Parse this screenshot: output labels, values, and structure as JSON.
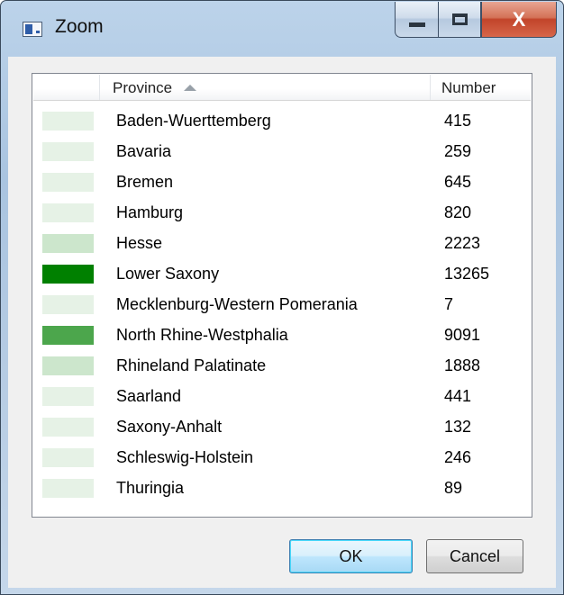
{
  "window": {
    "title": "Zoom",
    "icon": "app-window-icon"
  },
  "caption_buttons": {
    "minimize_icon": "minimize-icon",
    "maximize_icon": "maximize-icon",
    "close_label": "X"
  },
  "list": {
    "columns": [
      {
        "label": ""
      },
      {
        "label": "Province",
        "sort": "ascending"
      },
      {
        "label": "Number"
      }
    ],
    "rows": [
      {
        "province": "Baden-Wuerttemberg",
        "number": "415",
        "color": "#e6f2e6"
      },
      {
        "province": "Bavaria",
        "number": "259",
        "color": "#e6f2e6"
      },
      {
        "province": "Bremen",
        "number": "645",
        "color": "#e6f2e6"
      },
      {
        "province": "Hamburg",
        "number": "820",
        "color": "#e6f2e6"
      },
      {
        "province": "Hesse",
        "number": "2223",
        "color": "#cce6cc"
      },
      {
        "province": "Lower Saxony",
        "number": "13265",
        "color": "#008000"
      },
      {
        "province": "Mecklenburg-Western Pomerania",
        "number": "7",
        "color": "#e6f2e6"
      },
      {
        "province": "North Rhine-Westphalia",
        "number": "9091",
        "color": "#4ca64c"
      },
      {
        "province": "Rhineland Palatinate",
        "number": "1888",
        "color": "#cce6cc"
      },
      {
        "province": "Saarland",
        "number": "441",
        "color": "#e6f2e6"
      },
      {
        "province": "Saxony-Anhalt",
        "number": "132",
        "color": "#e6f2e6"
      },
      {
        "province": "Schleswig-Holstein",
        "number": "246",
        "color": "#e6f2e6"
      },
      {
        "province": "Thuringia",
        "number": "89",
        "color": "#e6f2e6"
      }
    ]
  },
  "buttons": {
    "ok_label": "OK",
    "cancel_label": "Cancel"
  }
}
